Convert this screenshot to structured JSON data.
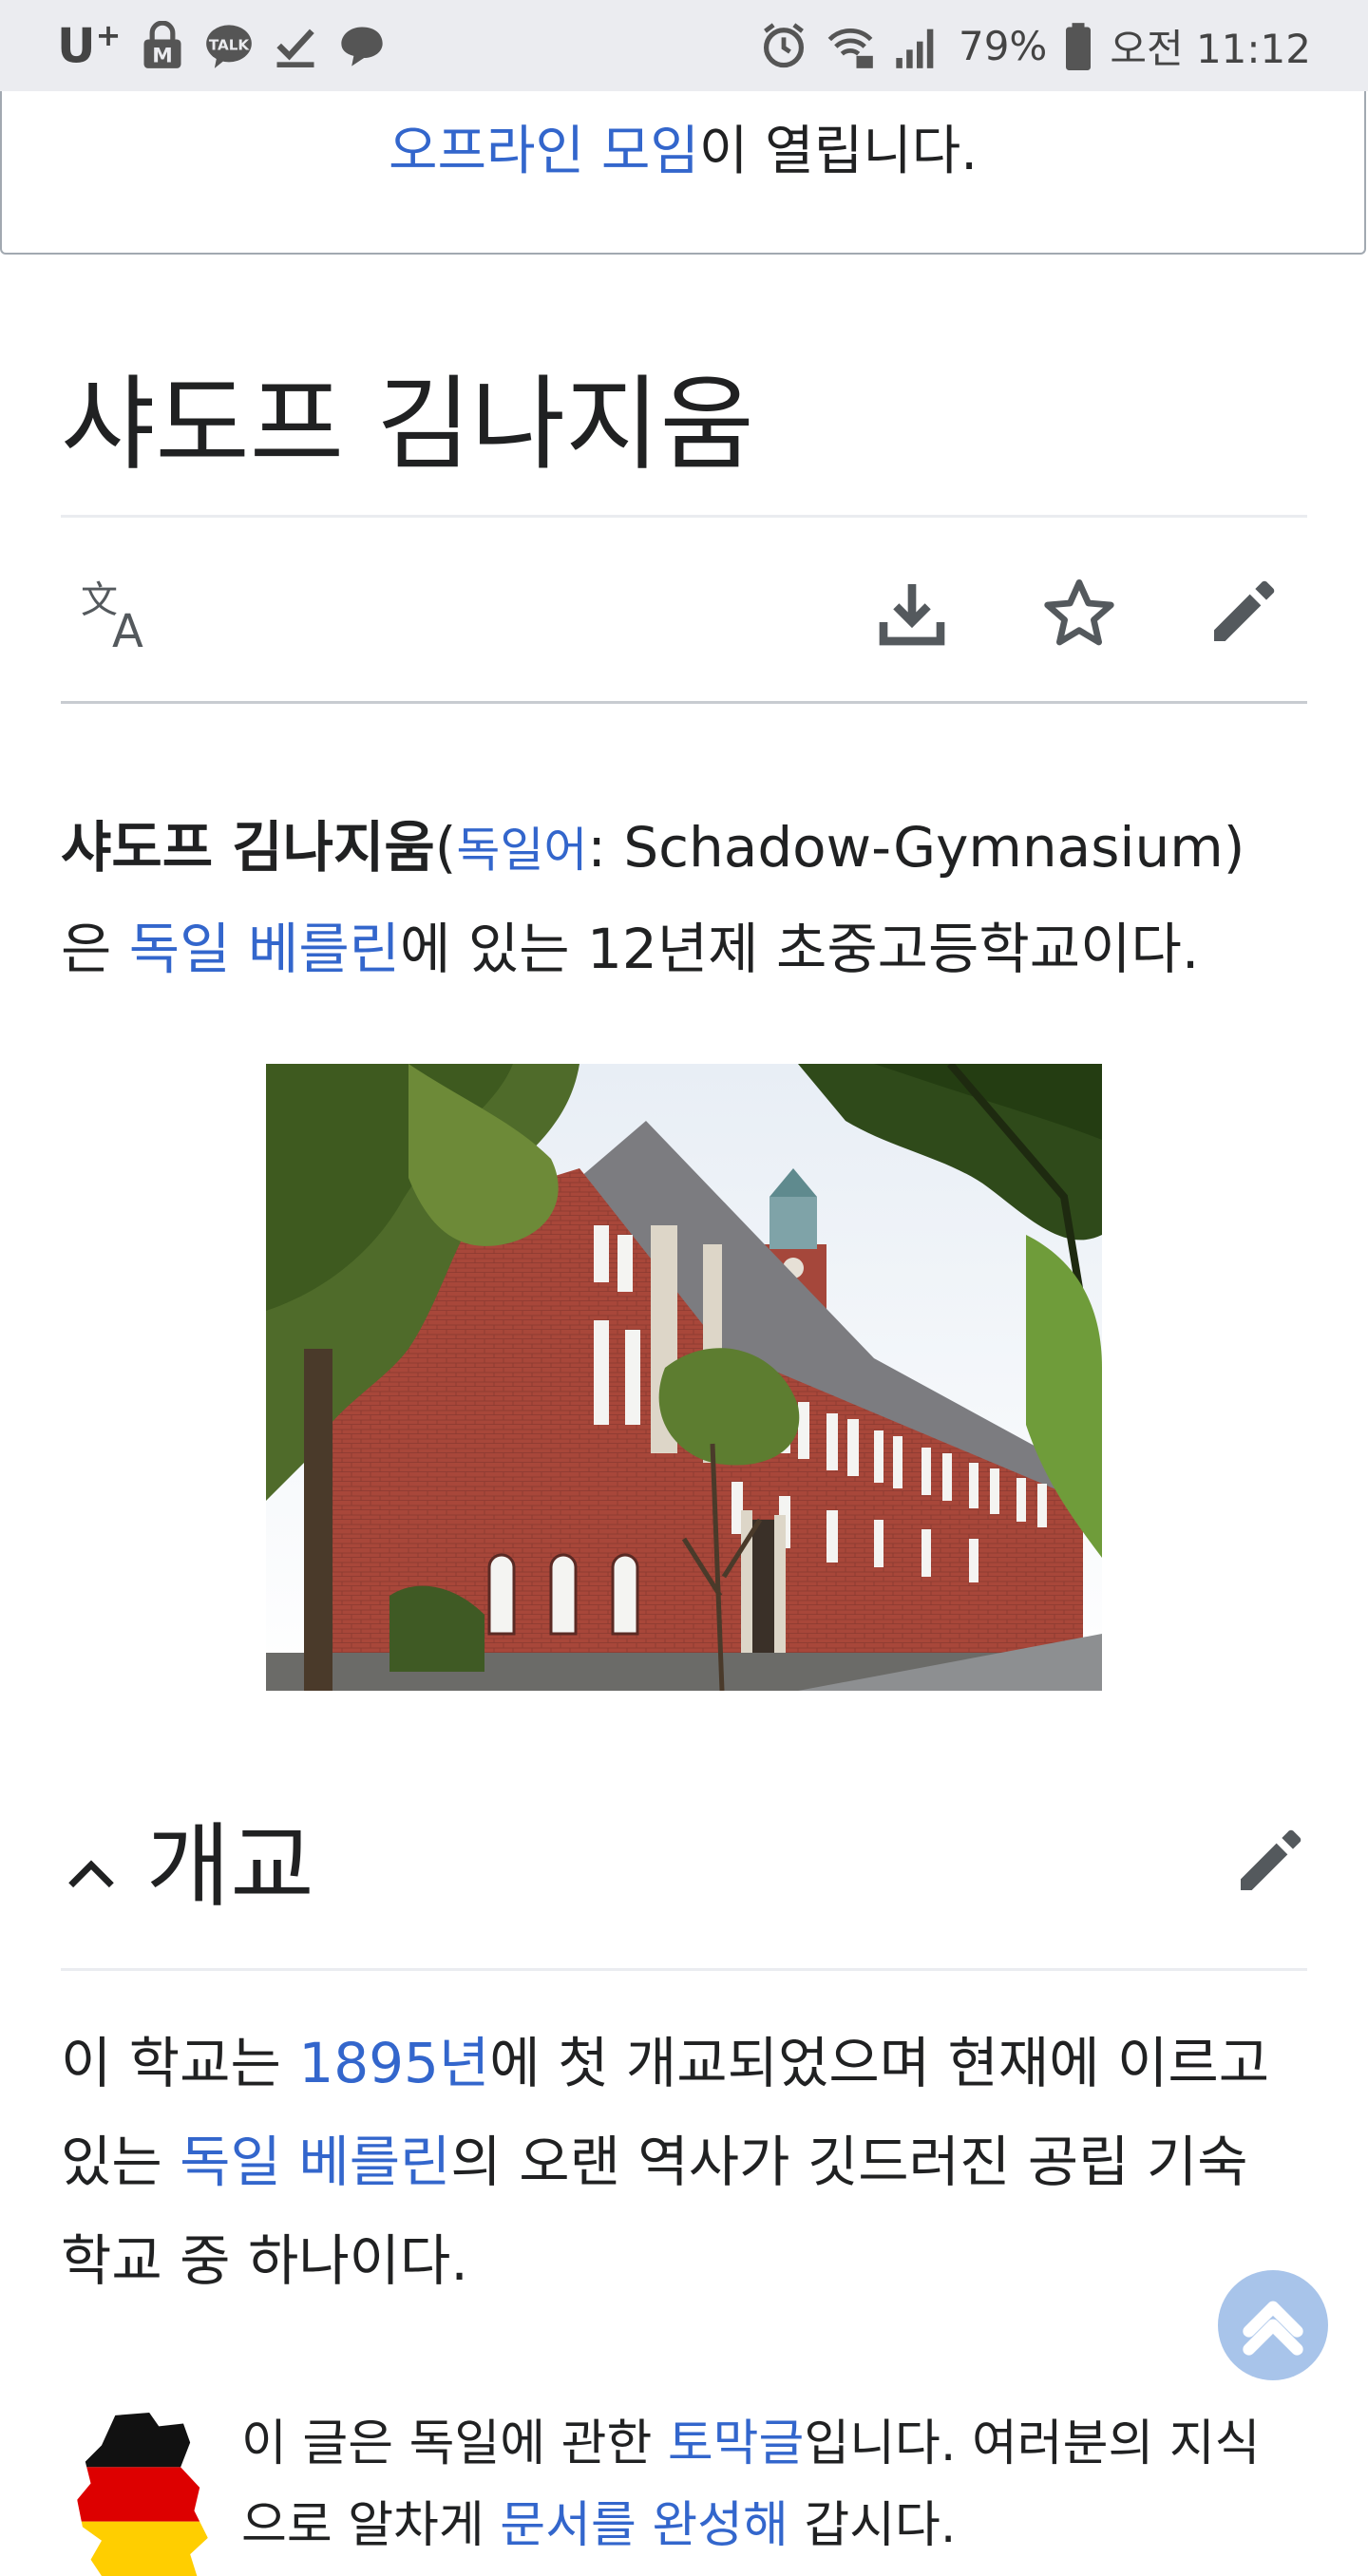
{
  "status_bar": {
    "carrier": "U",
    "carrier_sup": "+",
    "icons_left": [
      "lock-m-icon",
      "kakaotalk-icon",
      "download-done-icon",
      "chat-icon"
    ],
    "icons_right": [
      "alarm-icon",
      "wifi-lock-icon",
      "signal-icon"
    ],
    "battery": "79%",
    "time": "오전 11:12"
  },
  "banner": {
    "link": "오프라인 모임",
    "rest": "이 열립니다."
  },
  "page_title": "샤도프 김나지움",
  "actions": {
    "icons": [
      "translate-icon",
      "download-icon",
      "star-icon",
      "edit-icon"
    ]
  },
  "intro": {
    "bold_name": "샤도프 김나지움",
    "open_paren": "(",
    "lang_link": "독일어",
    "lang_value": ": Schadow-Gymnasium)",
    "particle": "은 ",
    "place_link": "독일 베를린",
    "rest": "에 있는 12년제 초중고등학교이다."
  },
  "photo": {
    "subject": "red brick school building with trees"
  },
  "section": {
    "title": "개교",
    "text_1": "이 학교는 ",
    "year_link": "1895년",
    "text_2": "에 첫 개교되었으며 현재에 이르고 있는 ",
    "place_link": "독일 베를린",
    "text_3": "의 오랜 역사가 깃드러진 공립 기숙 학교 중 하나이다."
  },
  "stub": {
    "text_1": "이 글은 독일에 관한 ",
    "stub_link": "토막글",
    "text_2": "입니다. 여러분의 지식으로 알차게 ",
    "complete_link": "문서를 완성해",
    "text_3": " 갑시다."
  },
  "colors": {
    "link": "#3366cc",
    "text": "#202122",
    "status_bar_bg": "#ebecf0",
    "to_top_bg": "#a8c4ea"
  }
}
